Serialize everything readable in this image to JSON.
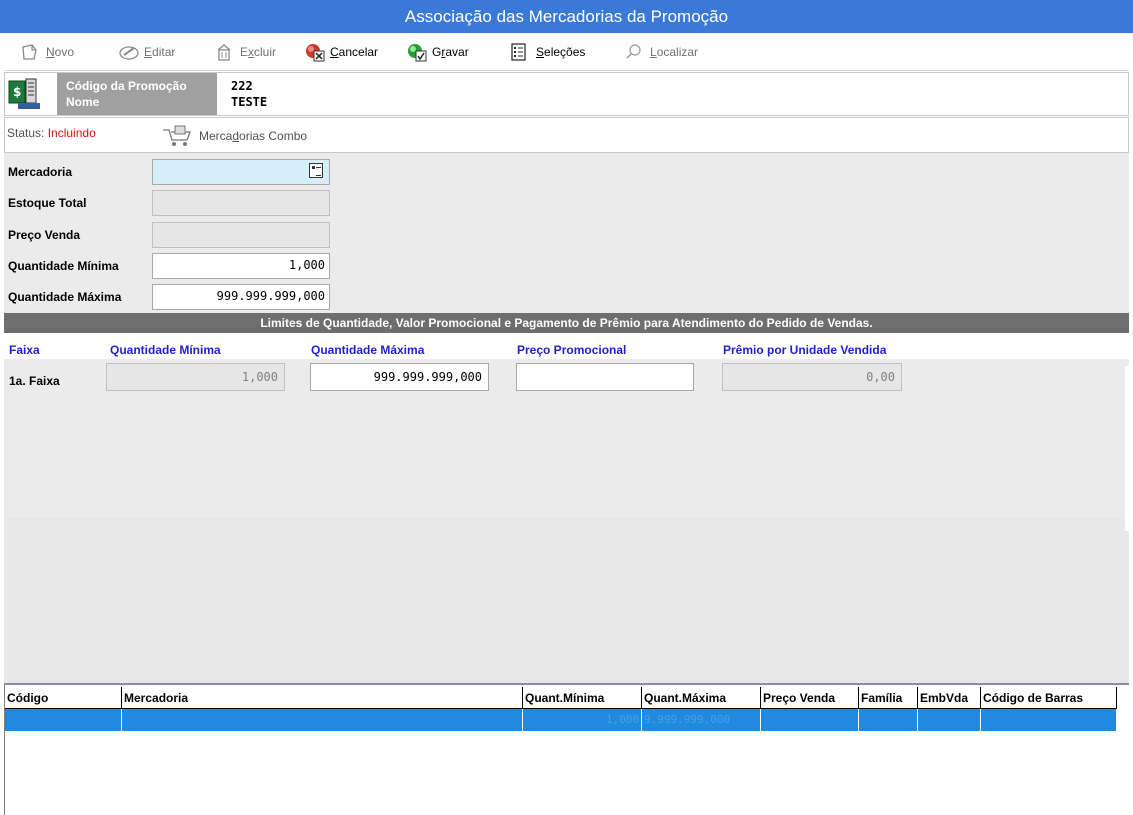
{
  "window": {
    "title": "Associação das Mercadorias da Promoção"
  },
  "toolbar": {
    "novo": {
      "pre": "",
      "u": "N",
      "post": "ovo"
    },
    "editar": {
      "pre": "",
      "u": "E",
      "post": "ditar"
    },
    "excluir": {
      "pre": "E",
      "u": "x",
      "post": "cluir"
    },
    "cancelar": {
      "pre": "",
      "u": "C",
      "post": "ancelar"
    },
    "gravar": {
      "pre": "G",
      "u": "r",
      "post": "avar"
    },
    "selecoes": {
      "pre": "",
      "u": "S",
      "post": "eleções"
    },
    "localizar": {
      "pre": "",
      "u": "L",
      "post": "ocalizar"
    }
  },
  "promo": {
    "code_label": "Código da Promoção",
    "name_label": "Nome",
    "code_value": "222",
    "name_value": "TESTE"
  },
  "status": {
    "label": "Status:",
    "value": "Incluindo",
    "combo": {
      "pre": "Merca",
      "u": "d",
      "post": "orias Combo"
    }
  },
  "form": {
    "mercadoria": {
      "label": "Mercadoria",
      "value": ""
    },
    "estoque": {
      "label": "Estoque Total",
      "value": ""
    },
    "preco": {
      "label": "Preço Venda",
      "value": ""
    },
    "qmin": {
      "label": "Quantidade Mínima",
      "value": "1,000"
    },
    "qmax": {
      "label": "Quantidade Máxima",
      "value": "999.999.999,000"
    }
  },
  "limits": {
    "title": "Limites de Quantidade, Valor Promocional  e Pagamento de Prêmio para Atendimento do Pedido de Vendas.",
    "headers": {
      "faixa": "Faixa",
      "qmin": "Quantidade Mínima",
      "qmax": "Quantidade Máxima",
      "preco": "Preço Promocional",
      "premio": "Prêmio por Unidade Vendida"
    },
    "row1": {
      "label": "1a. Faixa",
      "qmin": "1,000",
      "qmax": "999.999.999,000",
      "preco": "",
      "premio": "0,00"
    }
  },
  "grid": {
    "columns": [
      "Código",
      "Mercadoria",
      "Quant.Mínima",
      "Quant.Máxima",
      "Preço Venda",
      "Família",
      "EmbVda",
      "Código de Barras"
    ],
    "row": [
      "",
      "",
      "1,000",
      "9.999.999,000",
      "",
      "",
      "",
      ""
    ]
  },
  "colors": {
    "titlebar": "#3a79d6",
    "selected_row": "#1f8ae0",
    "header_blue": "#1f1fd0",
    "status_red": "#d01010"
  }
}
